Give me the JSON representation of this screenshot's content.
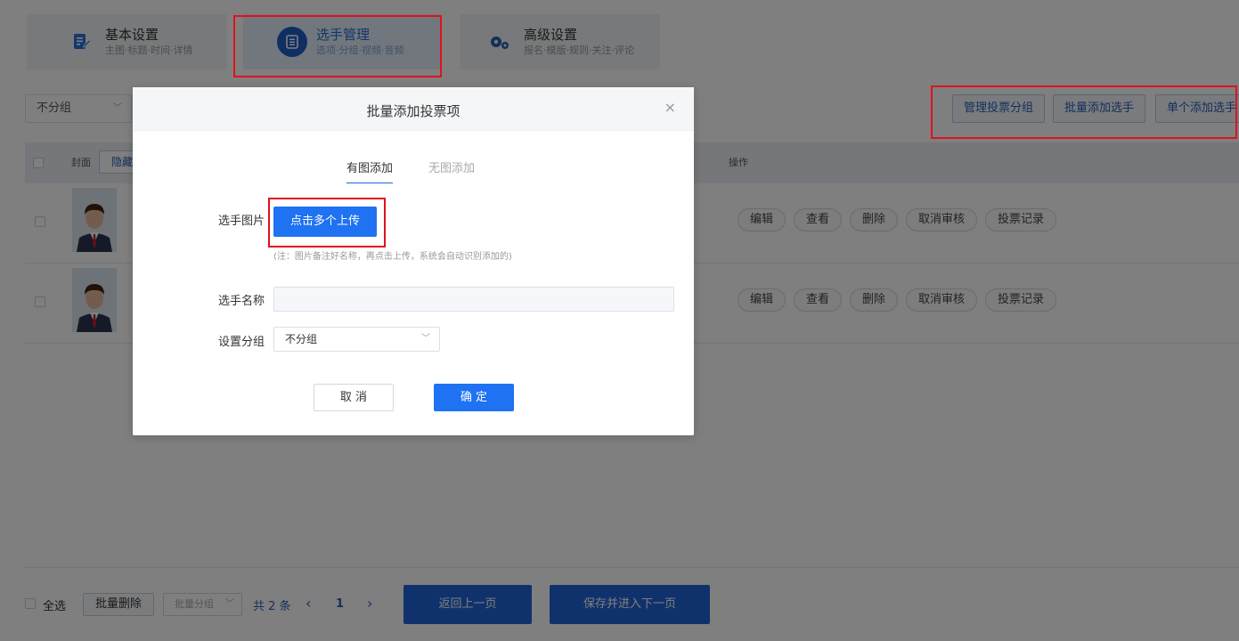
{
  "tabs": [
    {
      "title": "基本设置",
      "subtitle": "主图·标题·时间·详情",
      "icon": "edit-doc-icon",
      "active": false
    },
    {
      "title": "选手管理",
      "subtitle": "选项·分组·视频·音频",
      "icon": "list-icon",
      "active": true
    },
    {
      "title": "高级设置",
      "subtitle": "报名·模版·规则·关注·评论",
      "icon": "gears-icon",
      "active": false
    }
  ],
  "filter": {
    "group_value": "不分组"
  },
  "top_actions": {
    "manage_group": "管理投票分组",
    "batch_add": "批量添加选手",
    "single_add": "单个添加选手"
  },
  "table": {
    "columns": {
      "cover": "封面",
      "actions": "操作"
    },
    "hide_label": "隐藏",
    "row_actions": [
      "编辑",
      "查看",
      "删除",
      "取消审核",
      "投票记录"
    ]
  },
  "bottom": {
    "select_all": "全选",
    "batch_delete": "批量删除",
    "batch_group": "批量分组",
    "total": "共 2 条",
    "page": "1",
    "prev_icon": "‹",
    "next_icon": "›",
    "back": "返回上一页",
    "save_next": "保存并进入下一页"
  },
  "modal": {
    "title": "批量添加投票项",
    "close": "×",
    "tab_with_image": "有图添加",
    "tab_without_image": "无图添加",
    "label_image": "选手图片",
    "upload_button": "点击多个上传",
    "upload_hint": "(注：图片备注好名称，再点击上传，系统会自动识别添加的)",
    "label_name": "选手名称",
    "name_value": "",
    "label_group": "设置分组",
    "group_value": "不分组",
    "cancel": "取 消",
    "confirm": "确 定"
  },
  "colors": {
    "accent": "#1f72f2",
    "highlight_red": "#e0121f",
    "overlay": "rgba(0,0,0,0.5)"
  }
}
